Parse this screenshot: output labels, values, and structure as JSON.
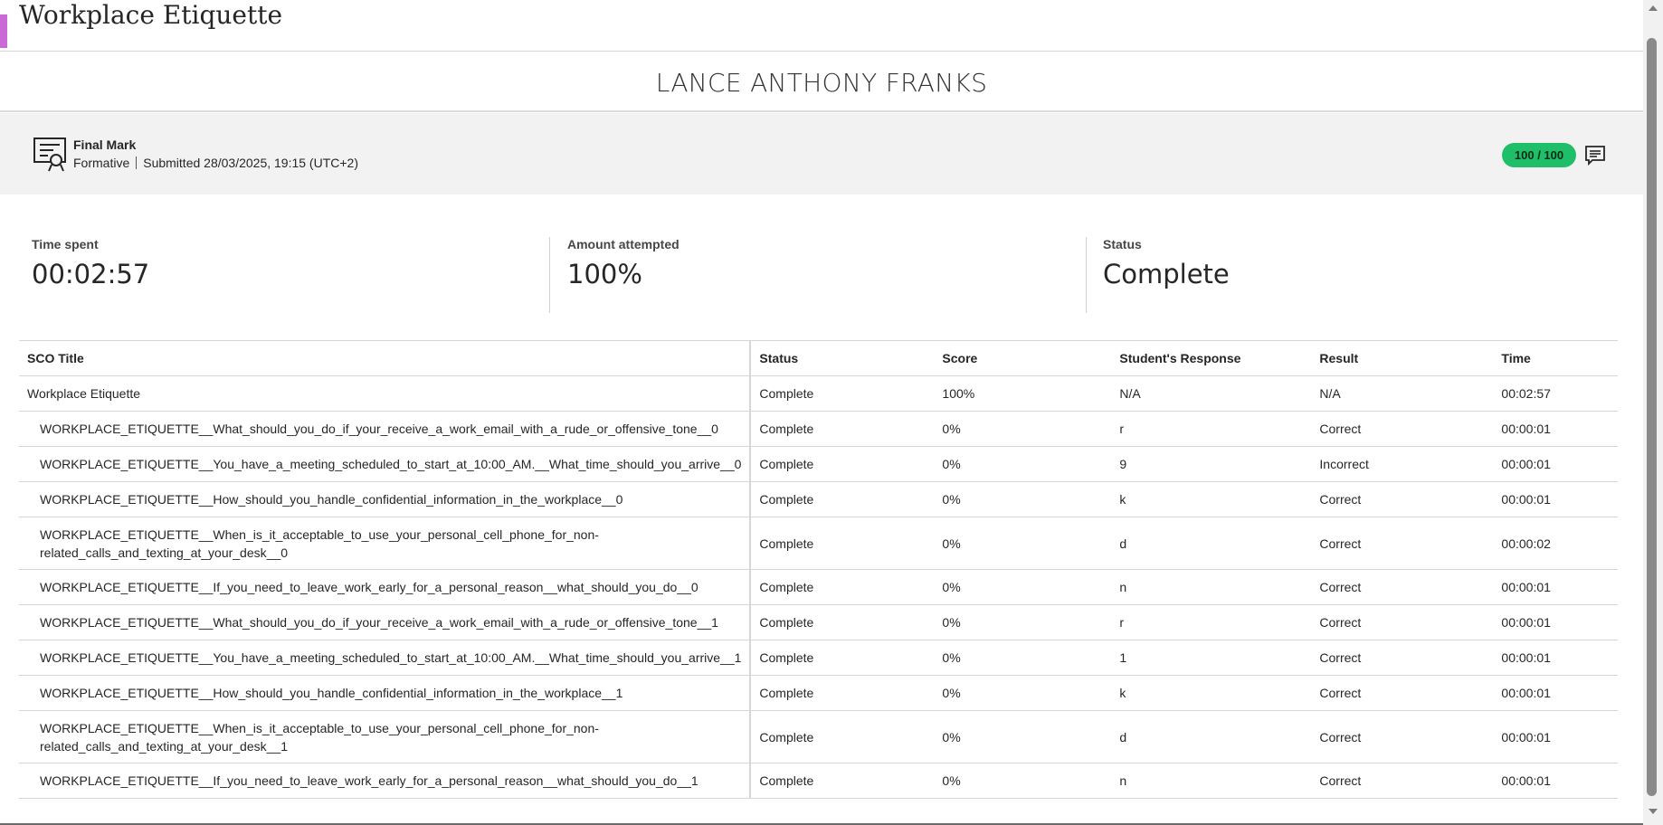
{
  "header": {
    "title": "Workplace Etiquette"
  },
  "student": {
    "name": "LANCE ANTHONY FRANKS"
  },
  "final_mark": {
    "label": "Final Mark",
    "type": "Formative",
    "submitted": "Submitted 28/03/2025, 19:15 (UTC+2)",
    "score": "100 / 100",
    "icon": "certificate-icon",
    "feedback_icon": "feedback-icon",
    "accent_color": "#1fbf6a"
  },
  "stats": {
    "time_spent": {
      "label": "Time spent",
      "value": "00:02:57"
    },
    "amount_attempted": {
      "label": "Amount attempted",
      "value": "100%"
    },
    "status": {
      "label": "Status",
      "value": "Complete"
    }
  },
  "table": {
    "headers": [
      "SCO Title",
      "Status",
      "Score",
      "Student's Response",
      "Result",
      "Time"
    ],
    "rows": [
      [
        "Workplace Etiquette",
        "Complete",
        "100%",
        "N/A",
        "N/A",
        "00:02:57"
      ],
      [
        "WORKPLACE_ETIQUETTE__What_should_you_do_if_your_receive_a_work_email_with_a_rude_or_offensive_tone__0",
        "Complete",
        "0%",
        "r",
        "Correct",
        "00:00:01"
      ],
      [
        "WORKPLACE_ETIQUETTE__You_have_a_meeting_scheduled_to_start_at_10:00_AM.__What_time_should_you_arrive__0",
        "Complete",
        "0%",
        "9",
        "Incorrect",
        "00:00:01"
      ],
      [
        "WORKPLACE_ETIQUETTE__How_should_you_handle_confidential_information_in_the_workplace__0",
        "Complete",
        "0%",
        "k",
        "Correct",
        "00:00:01"
      ],
      [
        "WORKPLACE_ETIQUETTE__When_is_it_acceptable_to_use_your_personal_cell_phone_for_non-related_calls_and_texting_at_your_desk__0",
        "Complete",
        "0%",
        "d",
        "Correct",
        "00:00:02"
      ],
      [
        "WORKPLACE_ETIQUETTE__If_you_need_to_leave_work_early_for_a_personal_reason__what_should_you_do__0",
        "Complete",
        "0%",
        "n",
        "Correct",
        "00:00:01"
      ],
      [
        "WORKPLACE_ETIQUETTE__What_should_you_do_if_your_receive_a_work_email_with_a_rude_or_offensive_tone__1",
        "Complete",
        "0%",
        "r",
        "Correct",
        "00:00:01"
      ],
      [
        "WORKPLACE_ETIQUETTE__You_have_a_meeting_scheduled_to_start_at_10:00_AM.__What_time_should_you_arrive__1",
        "Complete",
        "0%",
        "1",
        "Correct",
        "00:00:01"
      ],
      [
        "WORKPLACE_ETIQUETTE__How_should_you_handle_confidential_information_in_the_workplace__1",
        "Complete",
        "0%",
        "k",
        "Correct",
        "00:00:01"
      ],
      [
        "WORKPLACE_ETIQUETTE__When_is_it_acceptable_to_use_your_personal_cell_phone_for_non-related_calls_and_texting_at_your_desk__1",
        "Complete",
        "0%",
        "d",
        "Correct",
        "00:00:01"
      ],
      [
        "WORKPLACE_ETIQUETTE__If_you_need_to_leave_work_early_for_a_personal_reason__what_should_you_do__1",
        "Complete",
        "0%",
        "n",
        "Correct",
        "00:00:01"
      ]
    ]
  }
}
